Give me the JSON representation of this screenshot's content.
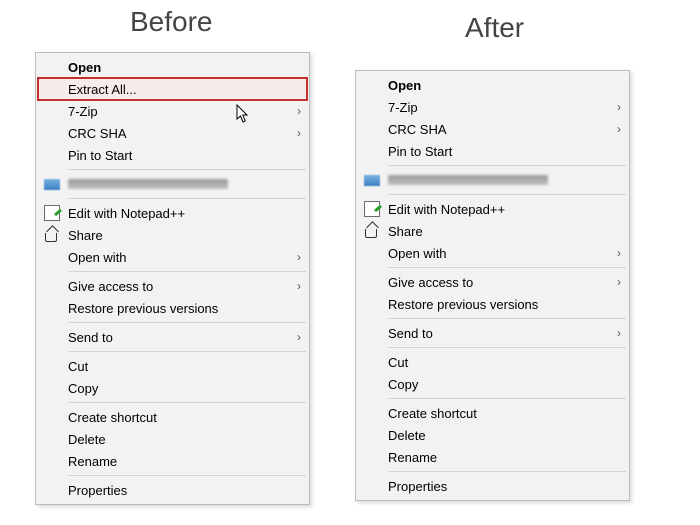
{
  "headings": {
    "before": "Before",
    "after": "After"
  },
  "before_menu": {
    "open": "Open",
    "extract_all": "Extract All...",
    "seven_zip": "7-Zip",
    "crc_sha": "CRC SHA",
    "pin_to_start": "Pin to Start",
    "install_with": "Install with Revo Uninstaller Pro",
    "edit_notepad": "Edit with Notepad++",
    "share": "Share",
    "open_with": "Open with",
    "give_access": "Give access to",
    "restore_prev": "Restore previous versions",
    "send_to": "Send to",
    "cut": "Cut",
    "copy": "Copy",
    "create_shortcut": "Create shortcut",
    "delete": "Delete",
    "rename": "Rename",
    "properties": "Properties"
  },
  "after_menu": {
    "open": "Open",
    "seven_zip": "7-Zip",
    "crc_sha": "CRC SHA",
    "pin_to_start": "Pin to Start",
    "install_with": "Install with Revo Uninstaller Pro",
    "edit_notepad": "Edit with Notepad++",
    "share": "Share",
    "open_with": "Open with",
    "give_access": "Give access to",
    "restore_prev": "Restore previous versions",
    "send_to": "Send to",
    "cut": "Cut",
    "copy": "Copy",
    "create_shortcut": "Create shortcut",
    "delete": "Delete",
    "rename": "Rename",
    "properties": "Properties"
  },
  "highlight": {
    "row": "extract_all"
  },
  "colors": {
    "highlight_border": "#c23030",
    "menu_bg": "#f2f2f2"
  }
}
